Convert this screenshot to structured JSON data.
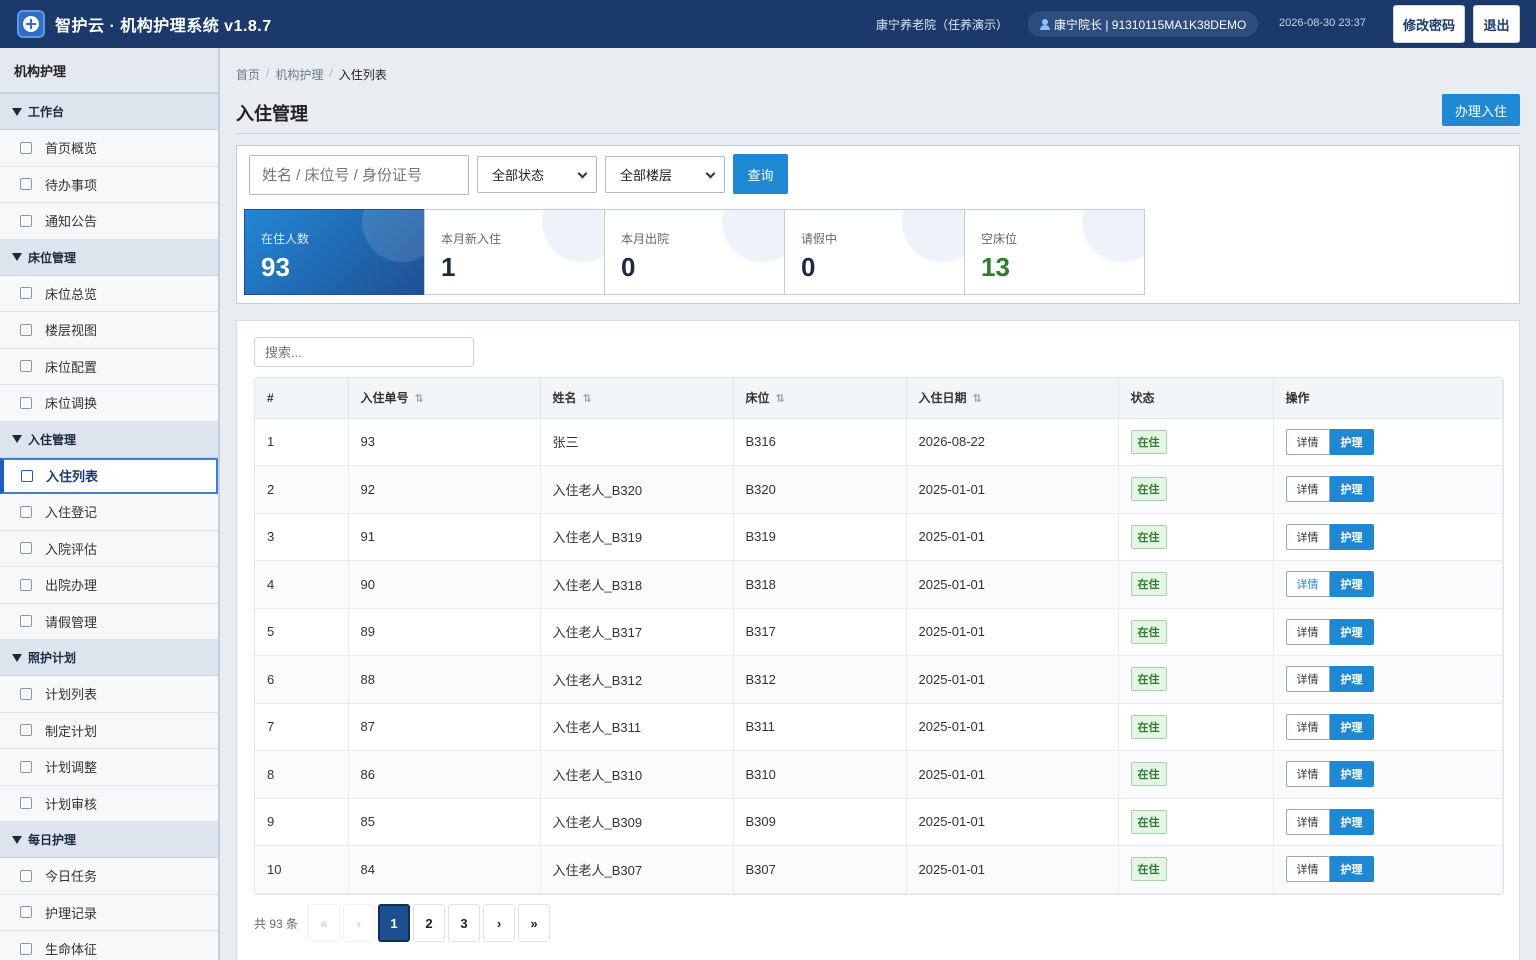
{
  "header": {
    "app_title": "智护云 · 机构护理系统 v1.8.7",
    "org_name": "康宁养老院（任养演示）",
    "user": "康宁院长 | 91310115MA1K38DEMO",
    "datetime": "2026-08-30 23:37",
    "btn_change_password": "修改密码",
    "btn_logout": "退出"
  },
  "sidebar": {
    "title": "机构护理",
    "groups": [
      {
        "label": "工作台",
        "items": [
          "首页概览",
          "待办事项",
          "通知公告"
        ]
      },
      {
        "label": "床位管理",
        "items": [
          "床位总览",
          "楼层视图",
          "床位配置",
          "床位调换"
        ]
      },
      {
        "label": "入住管理",
        "items": [
          "入住列表",
          "入住登记",
          "入院评估",
          "出院办理",
          "请假管理"
        ]
      },
      {
        "label": "照护计划",
        "items": [
          "计划列表",
          "制定计划",
          "计划调整",
          "计划审核"
        ]
      },
      {
        "label": "每日护理",
        "items": [
          "今日任务",
          "护理记录",
          "生命体征"
        ]
      }
    ],
    "active_item": "入住列表"
  },
  "breadcrumb": [
    "首页",
    "机构护理",
    "入住列表"
  ],
  "page": {
    "title": "入住管理",
    "btn_admit": "办理入住"
  },
  "filters": {
    "search_placeholder": "姓名 / 床位号 / 身份证号",
    "status_value": "全部状态",
    "floor_value": "全部楼层",
    "btn_query": "查询"
  },
  "stats": [
    {
      "label": "在住人数",
      "value": "93"
    },
    {
      "label": "本月新入住",
      "value": "1"
    },
    {
      "label": "本月出院",
      "value": "0"
    },
    {
      "label": "请假中",
      "value": "0"
    },
    {
      "label": "空床位",
      "value": "13"
    }
  ],
  "table": {
    "search_placeholder": "搜索...",
    "columns": [
      "#",
      "入住单号",
      "姓名",
      "床位",
      "入住日期",
      "状态",
      "操作"
    ],
    "sort_icon": "⇅",
    "btn_detail": "详情",
    "btn_care": "护理",
    "rows": [
      {
        "idx": "1",
        "no": "93",
        "name": "张三",
        "bed": "B316",
        "date": "2026-08-22",
        "status": "在住"
      },
      {
        "idx": "2",
        "no": "92",
        "name": "入住老人_B320",
        "bed": "B320",
        "date": "2025-01-01",
        "status": "在住"
      },
      {
        "idx": "3",
        "no": "91",
        "name": "入住老人_B319",
        "bed": "B319",
        "date": "2025-01-01",
        "status": "在住"
      },
      {
        "idx": "4",
        "no": "90",
        "name": "入住老人_B318",
        "bed": "B318",
        "date": "2025-01-01",
        "status": "在住"
      },
      {
        "idx": "5",
        "no": "89",
        "name": "入住老人_B317",
        "bed": "B317",
        "date": "2025-01-01",
        "status": "在住"
      },
      {
        "idx": "6",
        "no": "88",
        "name": "入住老人_B312",
        "bed": "B312",
        "date": "2025-01-01",
        "status": "在住"
      },
      {
        "idx": "7",
        "no": "87",
        "name": "入住老人_B311",
        "bed": "B311",
        "date": "2025-01-01",
        "status": "在住"
      },
      {
        "idx": "8",
        "no": "86",
        "name": "入住老人_B310",
        "bed": "B310",
        "date": "2025-01-01",
        "status": "在住"
      },
      {
        "idx": "9",
        "no": "85",
        "name": "入住老人_B309",
        "bed": "B309",
        "date": "2025-01-01",
        "status": "在住"
      },
      {
        "idx": "10",
        "no": "84",
        "name": "入住老人_B307",
        "bed": "B307",
        "date": "2025-01-01",
        "status": "在住"
      }
    ]
  },
  "pagination": {
    "total": "共 93 条",
    "first": "«",
    "prev": "‹",
    "pages": [
      "1",
      "2",
      "3"
    ],
    "current": "1",
    "next": "›",
    "last": "»"
  }
}
